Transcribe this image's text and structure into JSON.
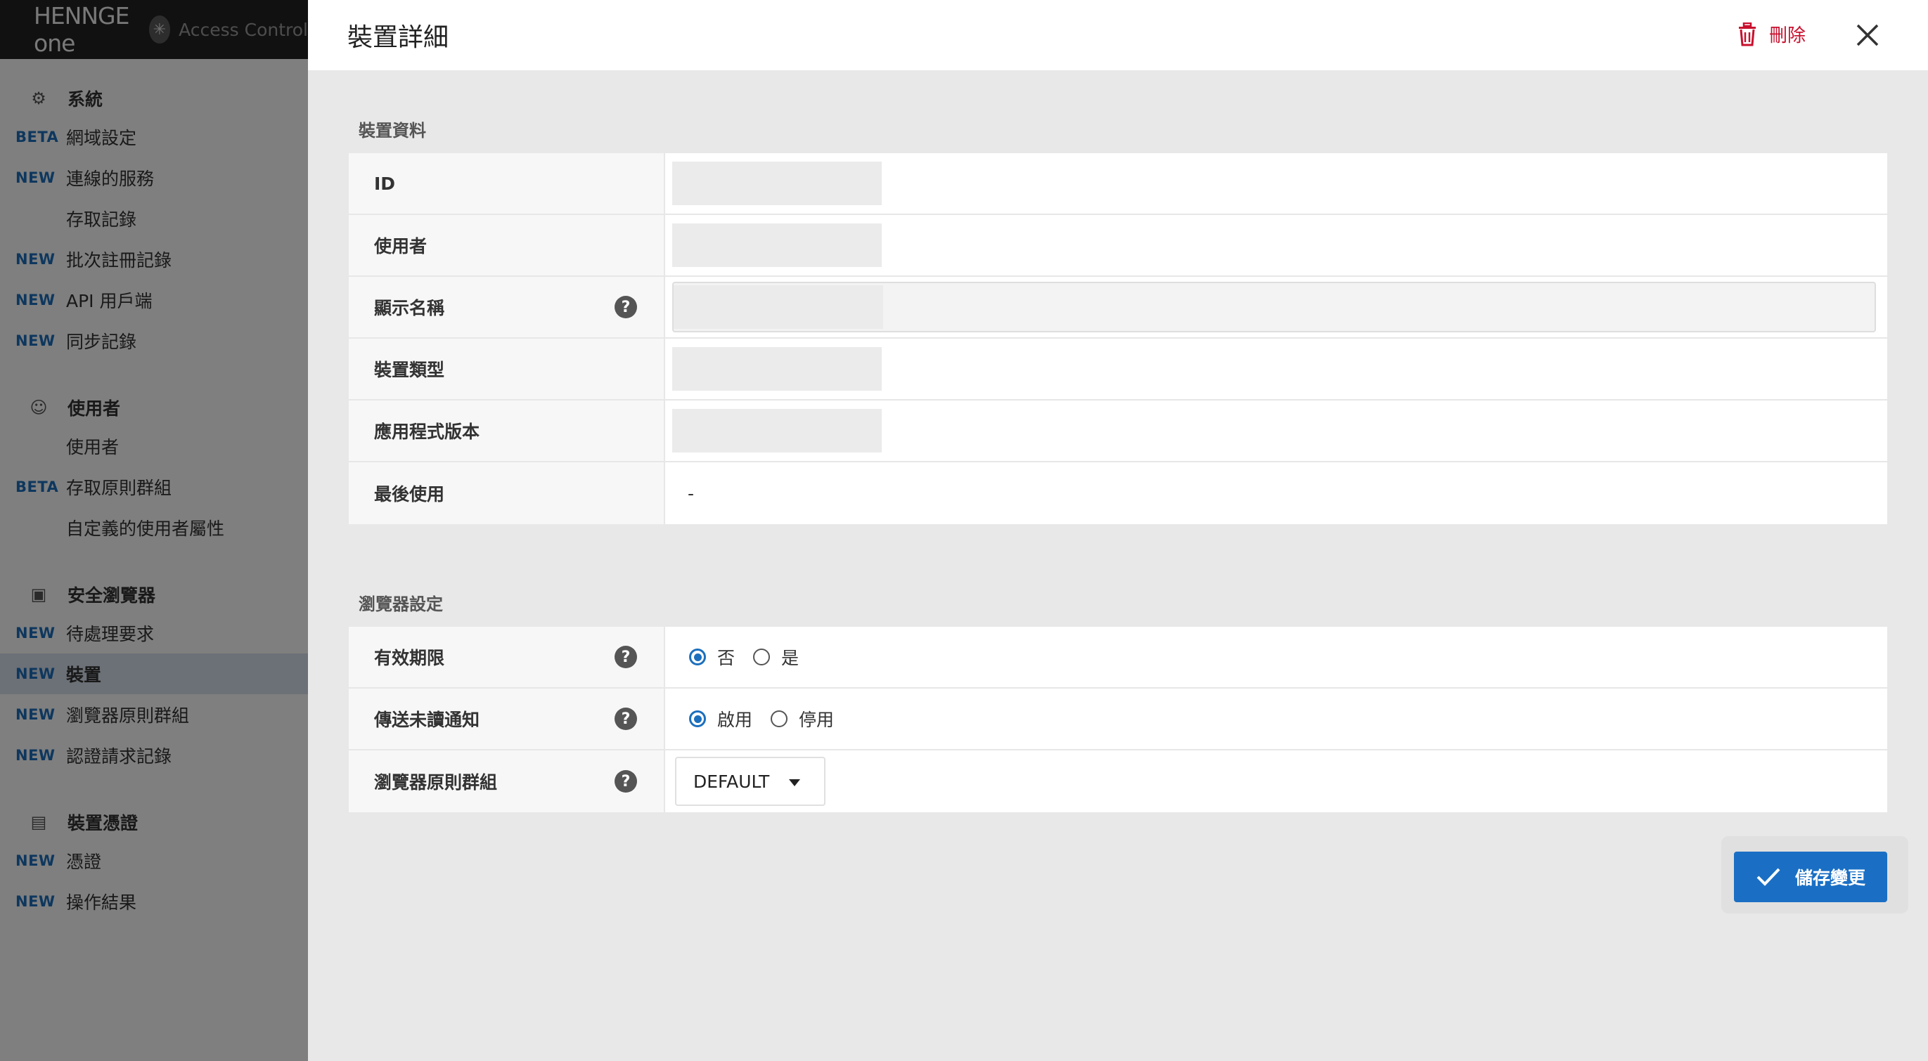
{
  "sidebar": {
    "brand": {
      "logo_text": "HENNGE one",
      "app_name": "Access Control"
    },
    "sections": [
      {
        "title": "系統",
        "icon": "gear-icon",
        "items": [
          {
            "tag": "BETA",
            "label": "網域設定"
          },
          {
            "tag": "NEW",
            "label": "連線的服務"
          },
          {
            "tag": "",
            "label": "存取記錄"
          },
          {
            "tag": "NEW",
            "label": "批次註冊記錄"
          },
          {
            "tag": "NEW",
            "label": "API 用戶端"
          },
          {
            "tag": "NEW",
            "label": "同步記錄"
          }
        ]
      },
      {
        "title": "使用者",
        "icon": "users-icon",
        "items": [
          {
            "tag": "",
            "label": "使用者"
          },
          {
            "tag": "BETA",
            "label": "存取原則群組"
          },
          {
            "tag": "",
            "label": "自定義的使用者屬性"
          }
        ]
      },
      {
        "title": "安全瀏覽器",
        "icon": "browser-icon",
        "items": [
          {
            "tag": "NEW",
            "label": "待處理要求"
          },
          {
            "tag": "NEW",
            "label": "裝置",
            "active": true
          },
          {
            "tag": "NEW",
            "label": "瀏覽器原則群組"
          },
          {
            "tag": "NEW",
            "label": "認證請求記錄"
          }
        ]
      },
      {
        "title": "裝置憑證",
        "icon": "certificate-icon",
        "items": [
          {
            "tag": "NEW",
            "label": "憑證"
          },
          {
            "tag": "NEW",
            "label": "操作結果"
          }
        ]
      }
    ]
  },
  "drawer": {
    "title": "裝置詳細",
    "delete_label": "刪除",
    "device_info": {
      "section_title": "裝置資料",
      "rows": {
        "id": {
          "label": "ID"
        },
        "user": {
          "label": "使用者"
        },
        "display_name": {
          "label": "顯示名稱"
        },
        "device_type": {
          "label": "裝置類型"
        },
        "app_version": {
          "label": "應用程式版本"
        },
        "last_used": {
          "label": "最後使用",
          "value": "-"
        }
      }
    },
    "browser_settings": {
      "section_title": "瀏覽器設定",
      "expiry": {
        "label": "有效期限",
        "options": [
          "否",
          "是"
        ],
        "selected": "否"
      },
      "unread_notify": {
        "label": "傳送未讀通知",
        "options": [
          "啟用",
          "停用"
        ],
        "selected": "啟用"
      },
      "policy_group": {
        "label": "瀏覽器原則群組",
        "value": "DEFAULT"
      }
    },
    "save_label": "儲存變更"
  },
  "colors": {
    "accent": "#1a6fc4",
    "tag_blue": "#1c6fbd",
    "danger": "#c8102e",
    "brand_bar": "#222222"
  }
}
